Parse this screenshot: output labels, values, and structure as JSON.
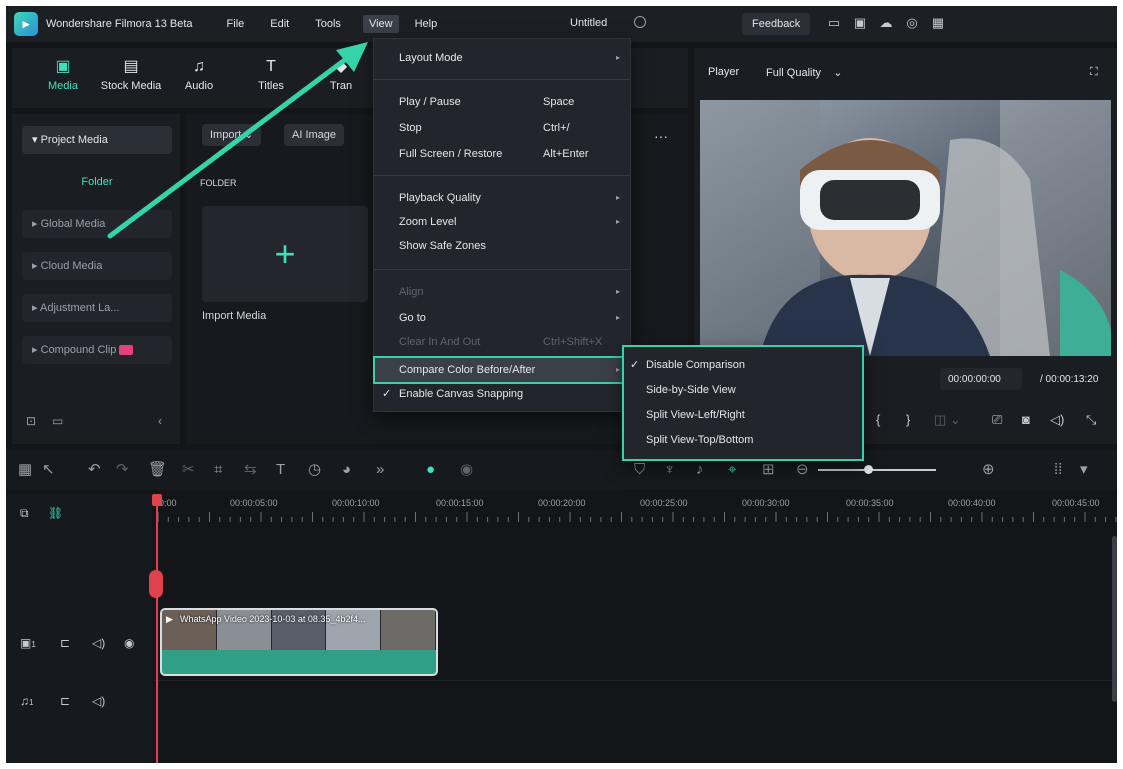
{
  "titlebar": {
    "app_name": "Wondershare Filmora 13 Beta",
    "menus": [
      "File",
      "Edit",
      "Tools",
      "View",
      "Help"
    ],
    "document_title": "Untitled",
    "feedback_label": "Feedback"
  },
  "media_tabs": [
    {
      "label": "Media",
      "icon": "media-icon",
      "glyph": "▣"
    },
    {
      "label": "Stock Media",
      "icon": "stock-media-icon",
      "glyph": "▤"
    },
    {
      "label": "Audio",
      "icon": "music-note-icon",
      "glyph": "♫"
    },
    {
      "label": "Titles",
      "icon": "text-icon",
      "glyph": "T"
    },
    {
      "label": "Tran",
      "icon": "transitions-icon",
      "glyph": "◆"
    }
  ],
  "sidebar": {
    "project_media": "Project Media",
    "folder": "Folder",
    "items": [
      "Global Media",
      "Cloud Media",
      "Adjustment La...",
      "Compound Clip"
    ]
  },
  "content": {
    "import_label": "Import",
    "ai_image_label": "AI Image",
    "folder_header": "FOLDER",
    "import_media_label": "Import Media",
    "import_plus": "+",
    "more_glyph": "···"
  },
  "player": {
    "player_label": "Player",
    "quality_label": "Full Quality",
    "current_time": "00:00:00:00",
    "total_time": "/ 00:00:13:20"
  },
  "timeline": {
    "ruler_labels": [
      "00:00",
      "00:00:05:00",
      "00:00:10:00",
      "00:00:15:00",
      "00:00:20:00",
      "00:00:25:00",
      "00:00:30:00",
      "00:00:35:00",
      "00:00:40:00",
      "00:00:45:00"
    ],
    "clip_title": "WhatsApp Video 2023-10-03 at 08.35_4b2f4...",
    "video_track_number": "1",
    "audio_track_number": "1"
  },
  "view_menu": {
    "layout_mode": "Layout Mode",
    "play_pause": "Play / Pause",
    "play_pause_shortcut": "Space",
    "stop": "Stop",
    "stop_shortcut": "Ctrl+/",
    "full_screen": "Full Screen / Restore",
    "full_screen_shortcut": "Alt+Enter",
    "playback_quality": "Playback Quality",
    "zoom_level": "Zoom Level",
    "show_safe_zones": "Show Safe Zones",
    "align": "Align",
    "go_to": "Go to",
    "clear_in_out": "Clear In And Out",
    "clear_in_out_shortcut": "Ctrl+Shift+X",
    "compare_color": "Compare Color Before/After",
    "enable_snapping": "Enable Canvas Snapping"
  },
  "compare_submenu": {
    "items": [
      "Disable Comparison",
      "Side-by-Side View",
      "Split View-Left/Right",
      "Split View-Top/Bottom"
    ],
    "checked_index": 0
  },
  "colors": {
    "accent": "#3fe0bc",
    "annotation": "#35d3a8",
    "playhead": "#e0424b"
  }
}
